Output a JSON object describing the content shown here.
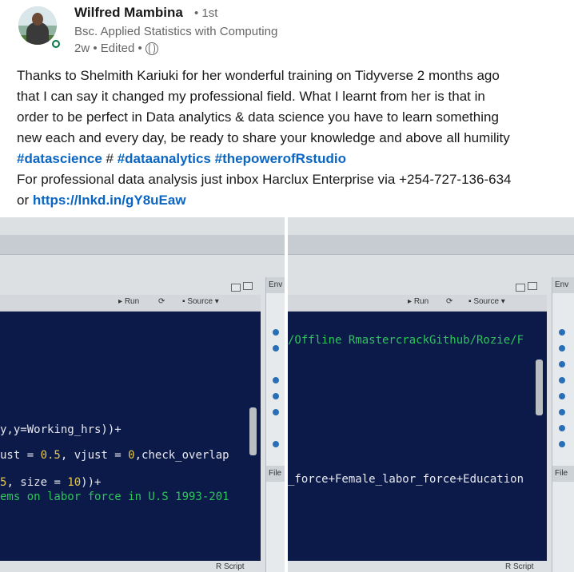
{
  "post": {
    "author_name": "Wilfred Mambina",
    "connection_degree": "• 1st",
    "headline": "Bsc. Applied Statistics with Computing",
    "meta_text": "2w • Edited •",
    "body": {
      "line1": "Thanks to Shelmith Kariuki for her wonderful training on Tidyverse 2 months ago",
      "line2": "that I can say it changed my professional field. What I learnt from her is that in",
      "line3": "order to be perfect in Data analytics & data science you have to learn something",
      "line4": "new each and every day, be ready to share your knowledge and above all humility",
      "tag1": "#datascience",
      "hash_sep": " # ",
      "tag2": "#dataanalytics",
      "tag3": "#thepowerofRstudio",
      "line6": "For professional data analysis just inbox Harclux Enterprise via +254-727-136-634",
      "line7_prefix": "or ",
      "link": "https://lnkd.in/gY8uEaw"
    }
  },
  "left_image": {
    "toolbar": {
      "run": "Run",
      "source": "Source"
    },
    "env_label": "Env",
    "files_label": "File",
    "code_lines": {
      "l1": "y,y=Working_hrs))+",
      "l2a": "ust = ",
      "l2n1": "0.5",
      "l2b": ", vjust = ",
      "l2n2": "0",
      "l2c": ",check_overlap",
      "l3n": "5",
      "l3a": ", size = ",
      "l3n2": "10",
      "l3b": "))+",
      "l4": "ems on labor force in U.S 1993-201"
    },
    "status": "R Script"
  },
  "right_image": {
    "toolbar": {
      "run": "Run",
      "source": "Source"
    },
    "env_label": "Env",
    "files_label": "File",
    "code_lines": {
      "l1": "/Offline RmastercrackGithub/Rozie/F",
      "l2": "_force+Female_labor_force+Education"
    },
    "status": "R Script"
  },
  "colors": {
    "link": "#0a66c2",
    "editor_bg": "#0c1a4a",
    "code_green": "#2dc45a",
    "online": "#057642"
  }
}
